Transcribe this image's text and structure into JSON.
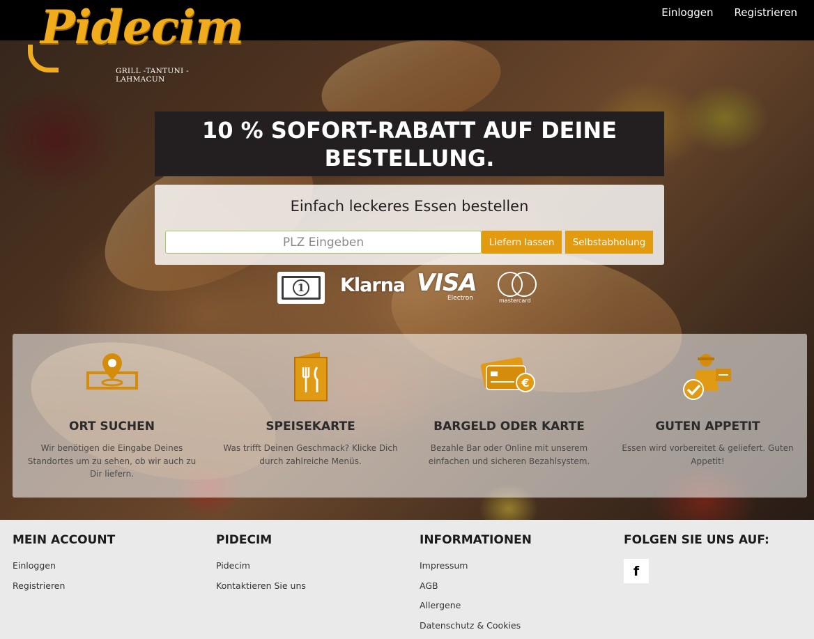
{
  "header": {
    "logo_word": "Pidecim",
    "logo_tagline": "GRILL -TANTUNI -LAHMACUN",
    "nav": [
      {
        "label": "Einloggen"
      },
      {
        "label": "Registrieren"
      }
    ]
  },
  "promo": {
    "text": "10 % SOFORT-RABATT AUF DEINE BESTELLUNG."
  },
  "order": {
    "title": "Einfach leckeres Essen bestellen",
    "plz_placeholder": "PLZ Eingeben",
    "plz_value": "",
    "deliver_label": "Liefern lassen",
    "pickup_label": "Selbstabholung"
  },
  "payments": {
    "cash_symbol": "1",
    "klarna": "Klarna",
    "visa": "VISA",
    "visa_sub": "Electron",
    "mastercard": "mastercard"
  },
  "steps": [
    {
      "title": "ORT SUCHEN",
      "text": "Wir benötigen die Eingabe Deines Standortes um zu sehen, ob wir auch zu Dir liefern.",
      "icon": "location-pin-icon"
    },
    {
      "title": "SPEISEKARTE",
      "text": "Was trifft Deinen Geschmack? Klicke Dich durch zahlreiche Menüs.",
      "icon": "menu-card-icon"
    },
    {
      "title": "BARGELD ODER KARTE",
      "text": "Bezahle Bar oder Online mit unserem einfachen und sicheren Bezahlsystem.",
      "icon": "payment-card-icon"
    },
    {
      "title": "GUTEN APPETIT",
      "text": "Essen wird vorbereitet & geliefert. Guten Appetit!",
      "icon": "delivery-person-icon"
    }
  ],
  "footer": {
    "columns": [
      {
        "title": "MEIN ACCOUNT",
        "links": [
          "Einloggen",
          "Registrieren"
        ]
      },
      {
        "title": "PIDECIM",
        "links": [
          "Pidecim",
          "Kontaktieren Sie uns"
        ]
      },
      {
        "title": "INFORMATIONEN",
        "links": [
          "Impressum",
          "AGB",
          "Allergene",
          "Datenschutz & Cookies"
        ]
      },
      {
        "title": "FOLGEN SIE UNS AUF:",
        "links": []
      }
    ],
    "facebook_glyph": "f"
  },
  "colors": {
    "brand_orange": "#e29a0f",
    "logo_yellow": "#f0ac1c",
    "promo_bg": "#231f20",
    "topbar_bg": "#000000",
    "footer_bg": "#eaeaeb"
  }
}
